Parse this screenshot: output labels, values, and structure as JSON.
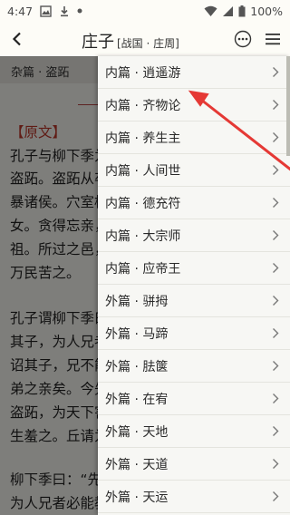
{
  "status_bar": {
    "time": "4:47",
    "battery": "100%",
    "icons": [
      "image-icon",
      "download-icon",
      "wifi-icon",
      "signal-icon",
      "battery-icon"
    ]
  },
  "app_bar": {
    "title": "庄子",
    "subtitle": "[战国 · 庄周]"
  },
  "chapter": {
    "label": "杂篇 · 盗跖"
  },
  "content": {
    "section_title": "【原文】",
    "lines": [
      "孔子与柳下季为友，柳下季之弟，名曰",
      "盗跖。盗跖从卒九千人，横行天下，侵",
      "暴诸侯。穴室枢户，驱人牛马，取人妇",
      "女。贪得忘亲，不顾父母兄弟，不祭先",
      "祖。所过之邑，大国守城，小国入保，",
      "万民苦之。",
      "孔子谓柳下季曰：“夫为人父者，必能诏",
      "其子，为人兄者，必能教其弟。若父不能",
      "诏其子，兄不能教其弟，则无贵父子兄",
      "弟之亲矣。今先生，世之才士也，弟为",
      "盗跖，为天下害，而弗能教也，丘窃为先",
      "生羞之。丘请为先生往说之。”",
      "柳下季曰：“先生言为人父者必能诏其子，",
      "为人兄者必能教其弟。"
    ]
  },
  "drawer": {
    "items": [
      {
        "label": "内篇 · 逍遥游"
      },
      {
        "label": "内篇 · 齐物论"
      },
      {
        "label": "内篇 · 养生主"
      },
      {
        "label": "内篇 · 人间世"
      },
      {
        "label": "内篇 · 德充符"
      },
      {
        "label": "内篇 · 大宗师"
      },
      {
        "label": "内篇 · 应帝王"
      },
      {
        "label": "外篇 · 骈拇"
      },
      {
        "label": "外篇 · 马蹄"
      },
      {
        "label": "外篇 · 胠箧"
      },
      {
        "label": "外篇 · 在宥"
      },
      {
        "label": "外篇 · 天地"
      },
      {
        "label": "外篇 · 天道"
      },
      {
        "label": "外篇 · 天运"
      }
    ]
  },
  "colors": {
    "accent_red": "#c0392b",
    "arrow_red": "#e53935",
    "background": "#fdfcf7",
    "drawer_bg": "#f7f7f4"
  }
}
